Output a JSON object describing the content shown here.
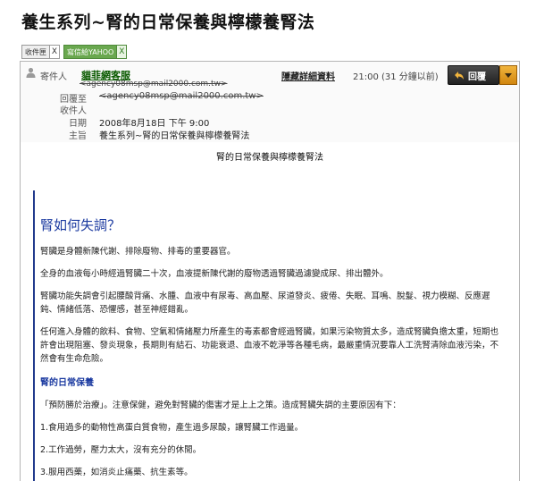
{
  "page": {
    "title": "養生系列~腎的日常保養與檸檬養腎法"
  },
  "tabs": [
    {
      "label": "收件匣",
      "close": "X"
    },
    {
      "label": "寫信給YAHOO",
      "close": "X"
    }
  ],
  "mail": {
    "sender_label": "寄件人",
    "sender_name": "貓菲網客服",
    "sender_addr": "<agency08msp@mail2000.com.tw>",
    "replyto_label": "回覆至",
    "replyto_value": "<agency08msp@mail2000.com.tw>",
    "recipient_label": "收件人",
    "date_label": "日期",
    "date_value": "2008年8月18日 下午 9:00",
    "subject_label": "主旨",
    "subject_value": "養生系列~腎的日常保養與檸檬養腎法",
    "hide_details": "隱藏詳細資料",
    "sent_time": "21:00 (31 分鐘以前)",
    "reply_label": "回覆"
  },
  "body": {
    "subject_center": "腎的日常保養與檸檬養腎法",
    "heading": "腎如何失調？",
    "p1": "腎臟是身體新陳代謝、排除廢物、排毒的重要器官。",
    "p2": "全身的血液每小時經過腎臟二十次，血液提新陳代謝的廢物透過腎臟過濾變成尿、排出體外。",
    "p3": "腎臟功能失調會引起腰酸背痛、水腫、血液中有尿毒、高血壓、尿道發炎、疲倦、失眠、耳鳴、脫髮、視力模糊、反應遲鈍、情緒低落、恐懼感，甚至神經錯亂。",
    "p4": "任何進入身體的飲料、食物、空氣和情緒壓力所產生的毒素都會經過腎臟，如果污染物質太多，造成腎臟負擔太重，短期也許會出現阻塞、發炎現象，長期則有結石、功能衰退、血液不乾淨等各種毛病，最嚴重情況要靠人工洗腎清除血液污染，不然會有生命危險。",
    "subheading": "腎的日常保養",
    "p5": "「預防勝於治療」。注意保健，避免對腎臟的傷害才是上上之策。造成腎臟失調的主要原因有下：",
    "p6": "1.食用過多的動物性高蛋白質食物，產生過多尿酸，讓腎臟工作過量。",
    "p7": "2.工作過勞，壓力太大，沒有充分的休閒。",
    "p8": "3.服用西藥，如消炎止痛藥、抗生素等。"
  }
}
